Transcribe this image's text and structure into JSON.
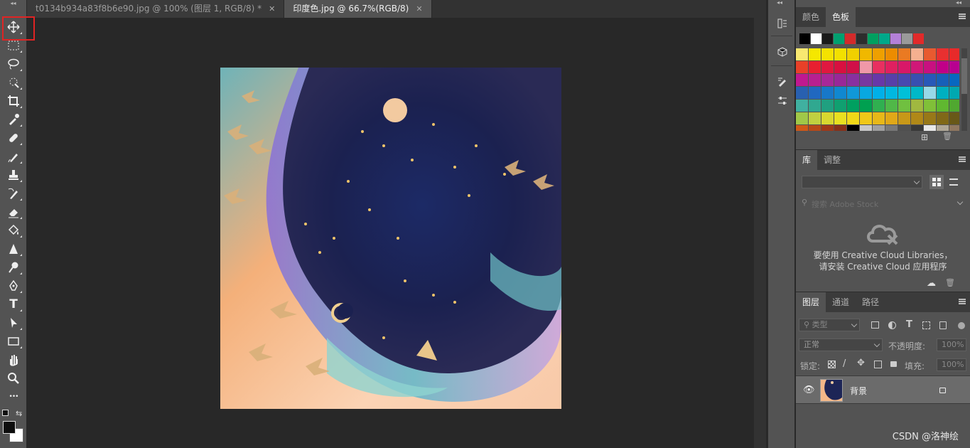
{
  "tabs": [
    {
      "label": "t0134b934a83f8b6e90.jpg @ 100% (图层 1, RGB/8) *",
      "close": "✕"
    },
    {
      "label": "印度色.jpg @ 66.7%(RGB/8)",
      "close": "✕"
    }
  ],
  "toolbar": {
    "collapse_glyph": "◂◂",
    "tools": [
      "move-icon",
      "marquee-icon",
      "lasso-icon",
      "quick-select-icon",
      "crop-icon",
      "eyedropper-icon",
      "healing-icon",
      "brush-icon",
      "stamp-icon",
      "history-brush-icon",
      "eraser-icon",
      "paint-bucket-icon",
      "sharpen-icon",
      "dodge-icon",
      "pen-icon",
      "type-icon",
      "path-select-icon",
      "rectangle-icon",
      "hand-icon",
      "zoom-icon",
      "more-icon"
    ],
    "type_glyph": "T",
    "more_glyph": "•••",
    "foreground_color": "#0d0d0d",
    "background_color": "#ffffff"
  },
  "swatch_panel": {
    "tabs": [
      "颜色",
      "色板"
    ],
    "active_tab": "色板",
    "recent_colors": [
      "#000000",
      "#ffffff",
      "#1a1a1a",
      "#00a070",
      "#d42a2a",
      "#2d2d2d",
      "#00a060",
      "#00a88a",
      "#b480d8",
      "#9a9a9a",
      "#e22a2a"
    ],
    "grid_colors": [
      "#f8e870",
      "#f5e700",
      "#f4e200",
      "#f2e000",
      "#f0d000",
      "#f0b800",
      "#eea000",
      "#ec8c00",
      "#ea7a22",
      "#f4b090",
      "#e85a30",
      "#e83030",
      "#e82a2a",
      "#e84028",
      "#e82030",
      "#e01840",
      "#d81040",
      "#d01048",
      "#f098a8",
      "#e83060",
      "#e02060",
      "#d81868",
      "#d01878",
      "#c81080",
      "#c00088",
      "#b80090",
      "#c01890",
      "#b82090",
      "#a82898",
      "#982898",
      "#8830a0",
      "#7838a0",
      "#6838a8",
      "#5840a8",
      "#4848b0",
      "#3850b0",
      "#2858b8",
      "#1860b8",
      "#0868c0",
      "#2860b0",
      "#2068c0",
      "#1878c8",
      "#1088d0",
      "#1098d8",
      "#08a8e0",
      "#00b0e8",
      "#00b8e0",
      "#00c0d8",
      "#00b8c8",
      "#98d8e8",
      "#00b0c0",
      "#00a8b0",
      "#40b0a0",
      "#30a890",
      "#20a080",
      "#10a070",
      "#00a060",
      "#00a050",
      "#30b050",
      "#50b848",
      "#70c040",
      "#a0b840",
      "#80c038",
      "#60b830",
      "#50a830",
      "#a0c848",
      "#c0d040",
      "#d8d830",
      "#e8e020",
      "#f0d818",
      "#f0c818",
      "#e8b818",
      "#e0a818",
      "#c89818",
      "#b08818",
      "#987818",
      "#806818",
      "#685818",
      "#d05818",
      "#b84818",
      "#a03818",
      "#883018",
      "#000000",
      "#c8c8c8",
      "#a0a0a0",
      "#787878",
      "#505050",
      "#383838",
      "#e8e8e8",
      "#b0a898",
      "#907860"
    ],
    "new_glyph": "⊞",
    "delete_glyph": "🗑"
  },
  "library_panel": {
    "tabs": [
      "库",
      "调整"
    ],
    "active_tab": "库",
    "search_placeholder": "搜索 Adobe Stock",
    "message_line1": "要使用 Creative Cloud Libraries，",
    "message_line2": "请安装 Creative Cloud 应用程序"
  },
  "layers_panel": {
    "tabs": [
      "图层",
      "通道",
      "路径"
    ],
    "active_tab": "图层",
    "filter_label": "类型",
    "blend_mode": "正常",
    "opacity_label": "不透明度:",
    "opacity_value": "100%",
    "lock_label": "锁定:",
    "fill_label": "填充:",
    "fill_value": "100%",
    "layers": [
      {
        "name": "背景",
        "visible": true,
        "locked": true
      }
    ]
  },
  "watermark": "CSDN @洛神绘",
  "colors": {
    "highlight": "#e02424",
    "panel_bg": "#535353",
    "canvas_bg": "#282828"
  }
}
